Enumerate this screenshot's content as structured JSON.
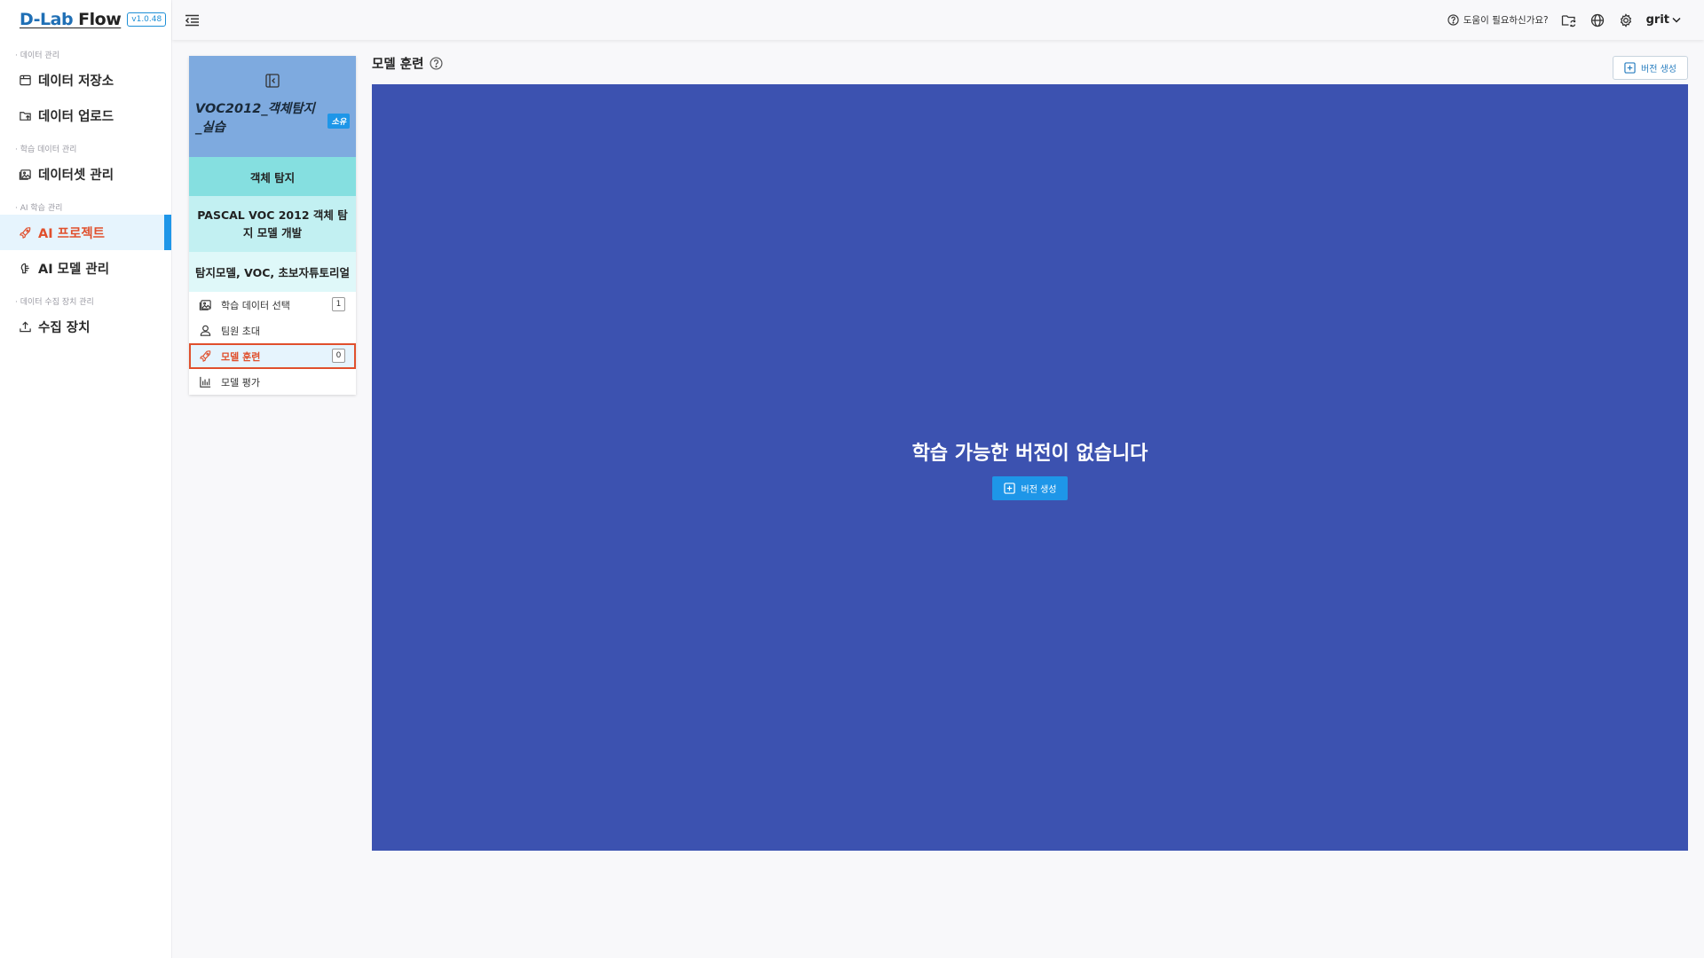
{
  "app": {
    "logo_part1": "D-Lab",
    "logo_part2": " Flow",
    "version": "v1.0.48"
  },
  "sidebar": {
    "groups": [
      {
        "label": "· 데이터 관리",
        "items": [
          {
            "label": "데이터 저장소",
            "icon": "storage-icon"
          },
          {
            "label": "데이터 업로드",
            "icon": "folder-upload-icon"
          }
        ]
      },
      {
        "label": "· 학습 데이터 관리",
        "items": [
          {
            "label": "데이터셋 관리",
            "icon": "images-icon"
          }
        ]
      },
      {
        "label": "· AI 학습 관리",
        "items": [
          {
            "label": "AI 프로젝트",
            "icon": "rocket-icon",
            "active": true
          },
          {
            "label": "AI 모델 관리",
            "icon": "brain-icon"
          }
        ]
      },
      {
        "label": "· 데이터 수집 장치 관리",
        "items": [
          {
            "label": "수집 장치",
            "icon": "upload-device-icon"
          }
        ]
      }
    ]
  },
  "topbar": {
    "help_label": "도움이 필요하신가요?",
    "user_name": "grit"
  },
  "project": {
    "title": "VOC2012_객체탐지_실습",
    "own_badge": "소유",
    "type": "객체 탐지",
    "description": "PASCAL VOC 2012 객체 탐지 모델 개발",
    "tags": "탐지모델, VOC, 초보자튜토리얼",
    "menu": [
      {
        "label": "학습 데이터 선택",
        "count": "1",
        "icon": "images-icon"
      },
      {
        "label": "팀원 초대",
        "count": "",
        "icon": "user-icon"
      },
      {
        "label": "모델 훈련",
        "count": "0",
        "icon": "rocket-icon",
        "active": true
      },
      {
        "label": "모델 평가",
        "count": "",
        "icon": "bar-chart-icon"
      }
    ]
  },
  "main": {
    "section_title": "모델 훈련",
    "create_version_label": "버전 생성",
    "empty_message": "학습 가능한 버전이 없습니다",
    "empty_create_label": "버전 생성"
  },
  "colors": {
    "accent_blue": "#1e96e8",
    "active_orange": "#e0502d",
    "content_bg": "#3c52b0",
    "project_header": "#7eaadf"
  }
}
